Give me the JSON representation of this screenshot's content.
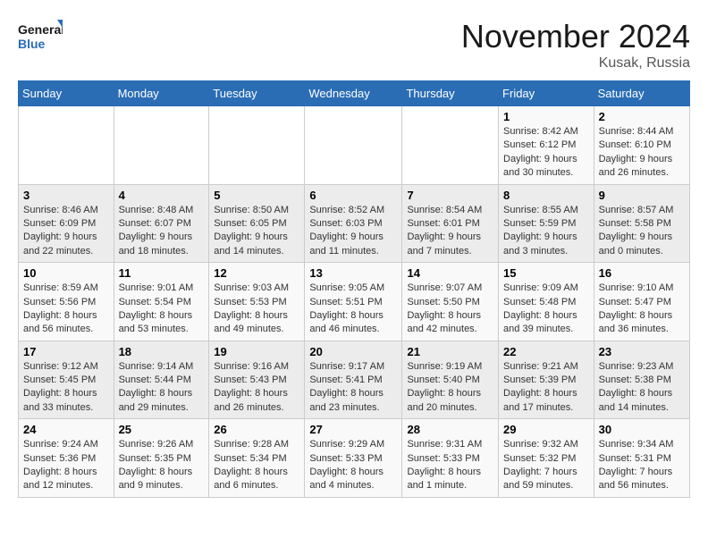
{
  "header": {
    "logo_line1": "General",
    "logo_line2": "Blue",
    "month": "November 2024",
    "location": "Kusak, Russia"
  },
  "weekdays": [
    "Sunday",
    "Monday",
    "Tuesday",
    "Wednesday",
    "Thursday",
    "Friday",
    "Saturday"
  ],
  "weeks": [
    [
      {
        "day": "",
        "info": ""
      },
      {
        "day": "",
        "info": ""
      },
      {
        "day": "",
        "info": ""
      },
      {
        "day": "",
        "info": ""
      },
      {
        "day": "",
        "info": ""
      },
      {
        "day": "1",
        "info": "Sunrise: 8:42 AM\nSunset: 6:12 PM\nDaylight: 9 hours and 30 minutes."
      },
      {
        "day": "2",
        "info": "Sunrise: 8:44 AM\nSunset: 6:10 PM\nDaylight: 9 hours and 26 minutes."
      }
    ],
    [
      {
        "day": "3",
        "info": "Sunrise: 8:46 AM\nSunset: 6:09 PM\nDaylight: 9 hours and 22 minutes."
      },
      {
        "day": "4",
        "info": "Sunrise: 8:48 AM\nSunset: 6:07 PM\nDaylight: 9 hours and 18 minutes."
      },
      {
        "day": "5",
        "info": "Sunrise: 8:50 AM\nSunset: 6:05 PM\nDaylight: 9 hours and 14 minutes."
      },
      {
        "day": "6",
        "info": "Sunrise: 8:52 AM\nSunset: 6:03 PM\nDaylight: 9 hours and 11 minutes."
      },
      {
        "day": "7",
        "info": "Sunrise: 8:54 AM\nSunset: 6:01 PM\nDaylight: 9 hours and 7 minutes."
      },
      {
        "day": "8",
        "info": "Sunrise: 8:55 AM\nSunset: 5:59 PM\nDaylight: 9 hours and 3 minutes."
      },
      {
        "day": "9",
        "info": "Sunrise: 8:57 AM\nSunset: 5:58 PM\nDaylight: 9 hours and 0 minutes."
      }
    ],
    [
      {
        "day": "10",
        "info": "Sunrise: 8:59 AM\nSunset: 5:56 PM\nDaylight: 8 hours and 56 minutes."
      },
      {
        "day": "11",
        "info": "Sunrise: 9:01 AM\nSunset: 5:54 PM\nDaylight: 8 hours and 53 minutes."
      },
      {
        "day": "12",
        "info": "Sunrise: 9:03 AM\nSunset: 5:53 PM\nDaylight: 8 hours and 49 minutes."
      },
      {
        "day": "13",
        "info": "Sunrise: 9:05 AM\nSunset: 5:51 PM\nDaylight: 8 hours and 46 minutes."
      },
      {
        "day": "14",
        "info": "Sunrise: 9:07 AM\nSunset: 5:50 PM\nDaylight: 8 hours and 42 minutes."
      },
      {
        "day": "15",
        "info": "Sunrise: 9:09 AM\nSunset: 5:48 PM\nDaylight: 8 hours and 39 minutes."
      },
      {
        "day": "16",
        "info": "Sunrise: 9:10 AM\nSunset: 5:47 PM\nDaylight: 8 hours and 36 minutes."
      }
    ],
    [
      {
        "day": "17",
        "info": "Sunrise: 9:12 AM\nSunset: 5:45 PM\nDaylight: 8 hours and 33 minutes."
      },
      {
        "day": "18",
        "info": "Sunrise: 9:14 AM\nSunset: 5:44 PM\nDaylight: 8 hours and 29 minutes."
      },
      {
        "day": "19",
        "info": "Sunrise: 9:16 AM\nSunset: 5:43 PM\nDaylight: 8 hours and 26 minutes."
      },
      {
        "day": "20",
        "info": "Sunrise: 9:17 AM\nSunset: 5:41 PM\nDaylight: 8 hours and 23 minutes."
      },
      {
        "day": "21",
        "info": "Sunrise: 9:19 AM\nSunset: 5:40 PM\nDaylight: 8 hours and 20 minutes."
      },
      {
        "day": "22",
        "info": "Sunrise: 9:21 AM\nSunset: 5:39 PM\nDaylight: 8 hours and 17 minutes."
      },
      {
        "day": "23",
        "info": "Sunrise: 9:23 AM\nSunset: 5:38 PM\nDaylight: 8 hours and 14 minutes."
      }
    ],
    [
      {
        "day": "24",
        "info": "Sunrise: 9:24 AM\nSunset: 5:36 PM\nDaylight: 8 hours and 12 minutes."
      },
      {
        "day": "25",
        "info": "Sunrise: 9:26 AM\nSunset: 5:35 PM\nDaylight: 8 hours and 9 minutes."
      },
      {
        "day": "26",
        "info": "Sunrise: 9:28 AM\nSunset: 5:34 PM\nDaylight: 8 hours and 6 minutes."
      },
      {
        "day": "27",
        "info": "Sunrise: 9:29 AM\nSunset: 5:33 PM\nDaylight: 8 hours and 4 minutes."
      },
      {
        "day": "28",
        "info": "Sunrise: 9:31 AM\nSunset: 5:33 PM\nDaylight: 8 hours and 1 minute."
      },
      {
        "day": "29",
        "info": "Sunrise: 9:32 AM\nSunset: 5:32 PM\nDaylight: 7 hours and 59 minutes."
      },
      {
        "day": "30",
        "info": "Sunrise: 9:34 AM\nSunset: 5:31 PM\nDaylight: 7 hours and 56 minutes."
      }
    ]
  ]
}
